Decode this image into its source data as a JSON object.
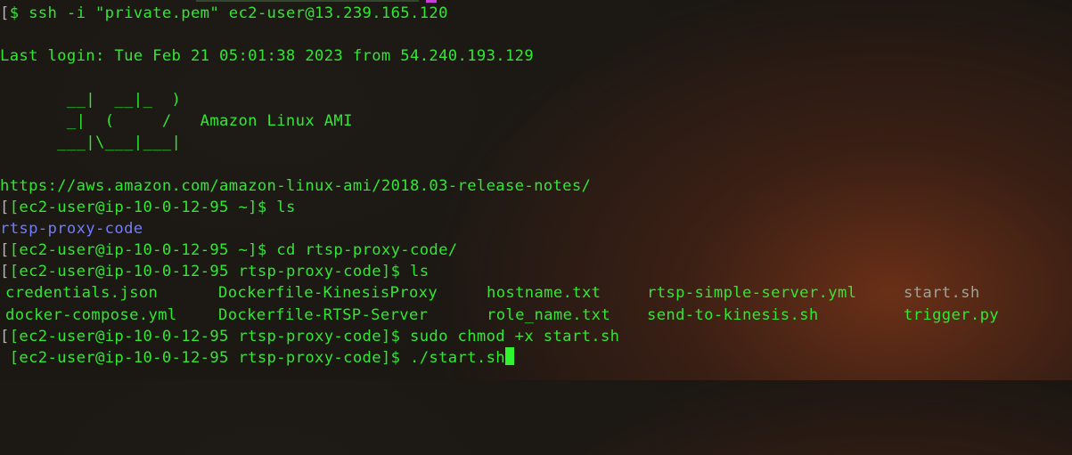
{
  "terminal": {
    "lines": [
      {
        "bracket": "[",
        "text": "$ ssh -i \"private.pem\" ec2-user@13.239.165.120"
      },
      {
        "bracket": "",
        "text": ""
      },
      {
        "bracket": "",
        "text": "Last login: Tue Feb 21 05:01:38 2023 from 54.240.193.129"
      },
      {
        "bracket": "",
        "text": ""
      },
      {
        "bracket": "",
        "text": "       __|  __|_  )"
      },
      {
        "bracket": "",
        "text": "       _|  (     /   Amazon Linux AMI"
      },
      {
        "bracket": "",
        "text": "      ___|\\___|___|"
      },
      {
        "bracket": "",
        "text": ""
      },
      {
        "bracket": "",
        "text": "https://aws.amazon.com/amazon-linux-ami/2018.03-release-notes/"
      },
      {
        "bracket": "[",
        "text": "[ec2-user@ip-10-0-12-95 ~]$ ls"
      },
      {
        "bracket": "",
        "text": "rtsp-proxy-code"
      },
      {
        "bracket": "[",
        "text": "[ec2-user@ip-10-0-12-95 ~]$ cd rtsp-proxy-code/"
      },
      {
        "bracket": "[",
        "text": "[ec2-user@ip-10-0-12-95 rtsp-proxy-code]$ ls"
      }
    ],
    "ls_output": {
      "row1": [
        "credentials.json",
        "Dockerfile-KinesisProxy",
        "hostname.txt",
        "rtsp-simple-server.yml",
        "start.sh"
      ],
      "row2": [
        "docker-compose.yml",
        "Dockerfile-RTSP-Server",
        "role_name.txt",
        "send-to-kinesis.sh",
        "trigger.py"
      ]
    },
    "after_lines": [
      {
        "bracket": "[",
        "text": "[ec2-user@ip-10-0-12-95 rtsp-proxy-code]$ sudo chmod +x start.sh"
      },
      {
        "bracket": "",
        "text": " [ec2-user@ip-10-0-12-95 rtsp-proxy-code]$ ./start.sh"
      }
    ],
    "colors": {
      "text": "#33e633",
      "directory": "#6f7cff",
      "cursor": "#2ef52e"
    }
  }
}
